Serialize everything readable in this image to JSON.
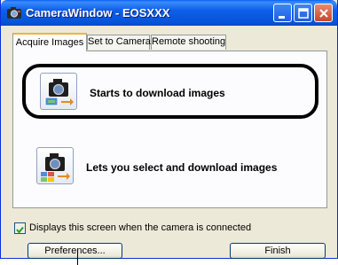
{
  "window": {
    "title": "CameraWindow - EOSXXX"
  },
  "tabs": [
    {
      "label": "Acquire Images",
      "active": true
    },
    {
      "label": "Set to Camera",
      "active": false
    },
    {
      "label": "Remote shooting",
      "active": false
    }
  ],
  "options": [
    {
      "label": "Starts to download images",
      "icon": "camera-download-icon",
      "highlighted": true
    },
    {
      "label": "Lets you select and download images",
      "icon": "camera-select-icon",
      "highlighted": false
    }
  ],
  "checkbox": {
    "label": "Displays this screen when the camera is connected",
    "checked": true
  },
  "buttons": {
    "preferences": "Preferences...",
    "finish": "Finish"
  },
  "colors": {
    "titlebar": "#0553d8",
    "highlight_border": "#000000",
    "panel": "#fcfcfe"
  }
}
